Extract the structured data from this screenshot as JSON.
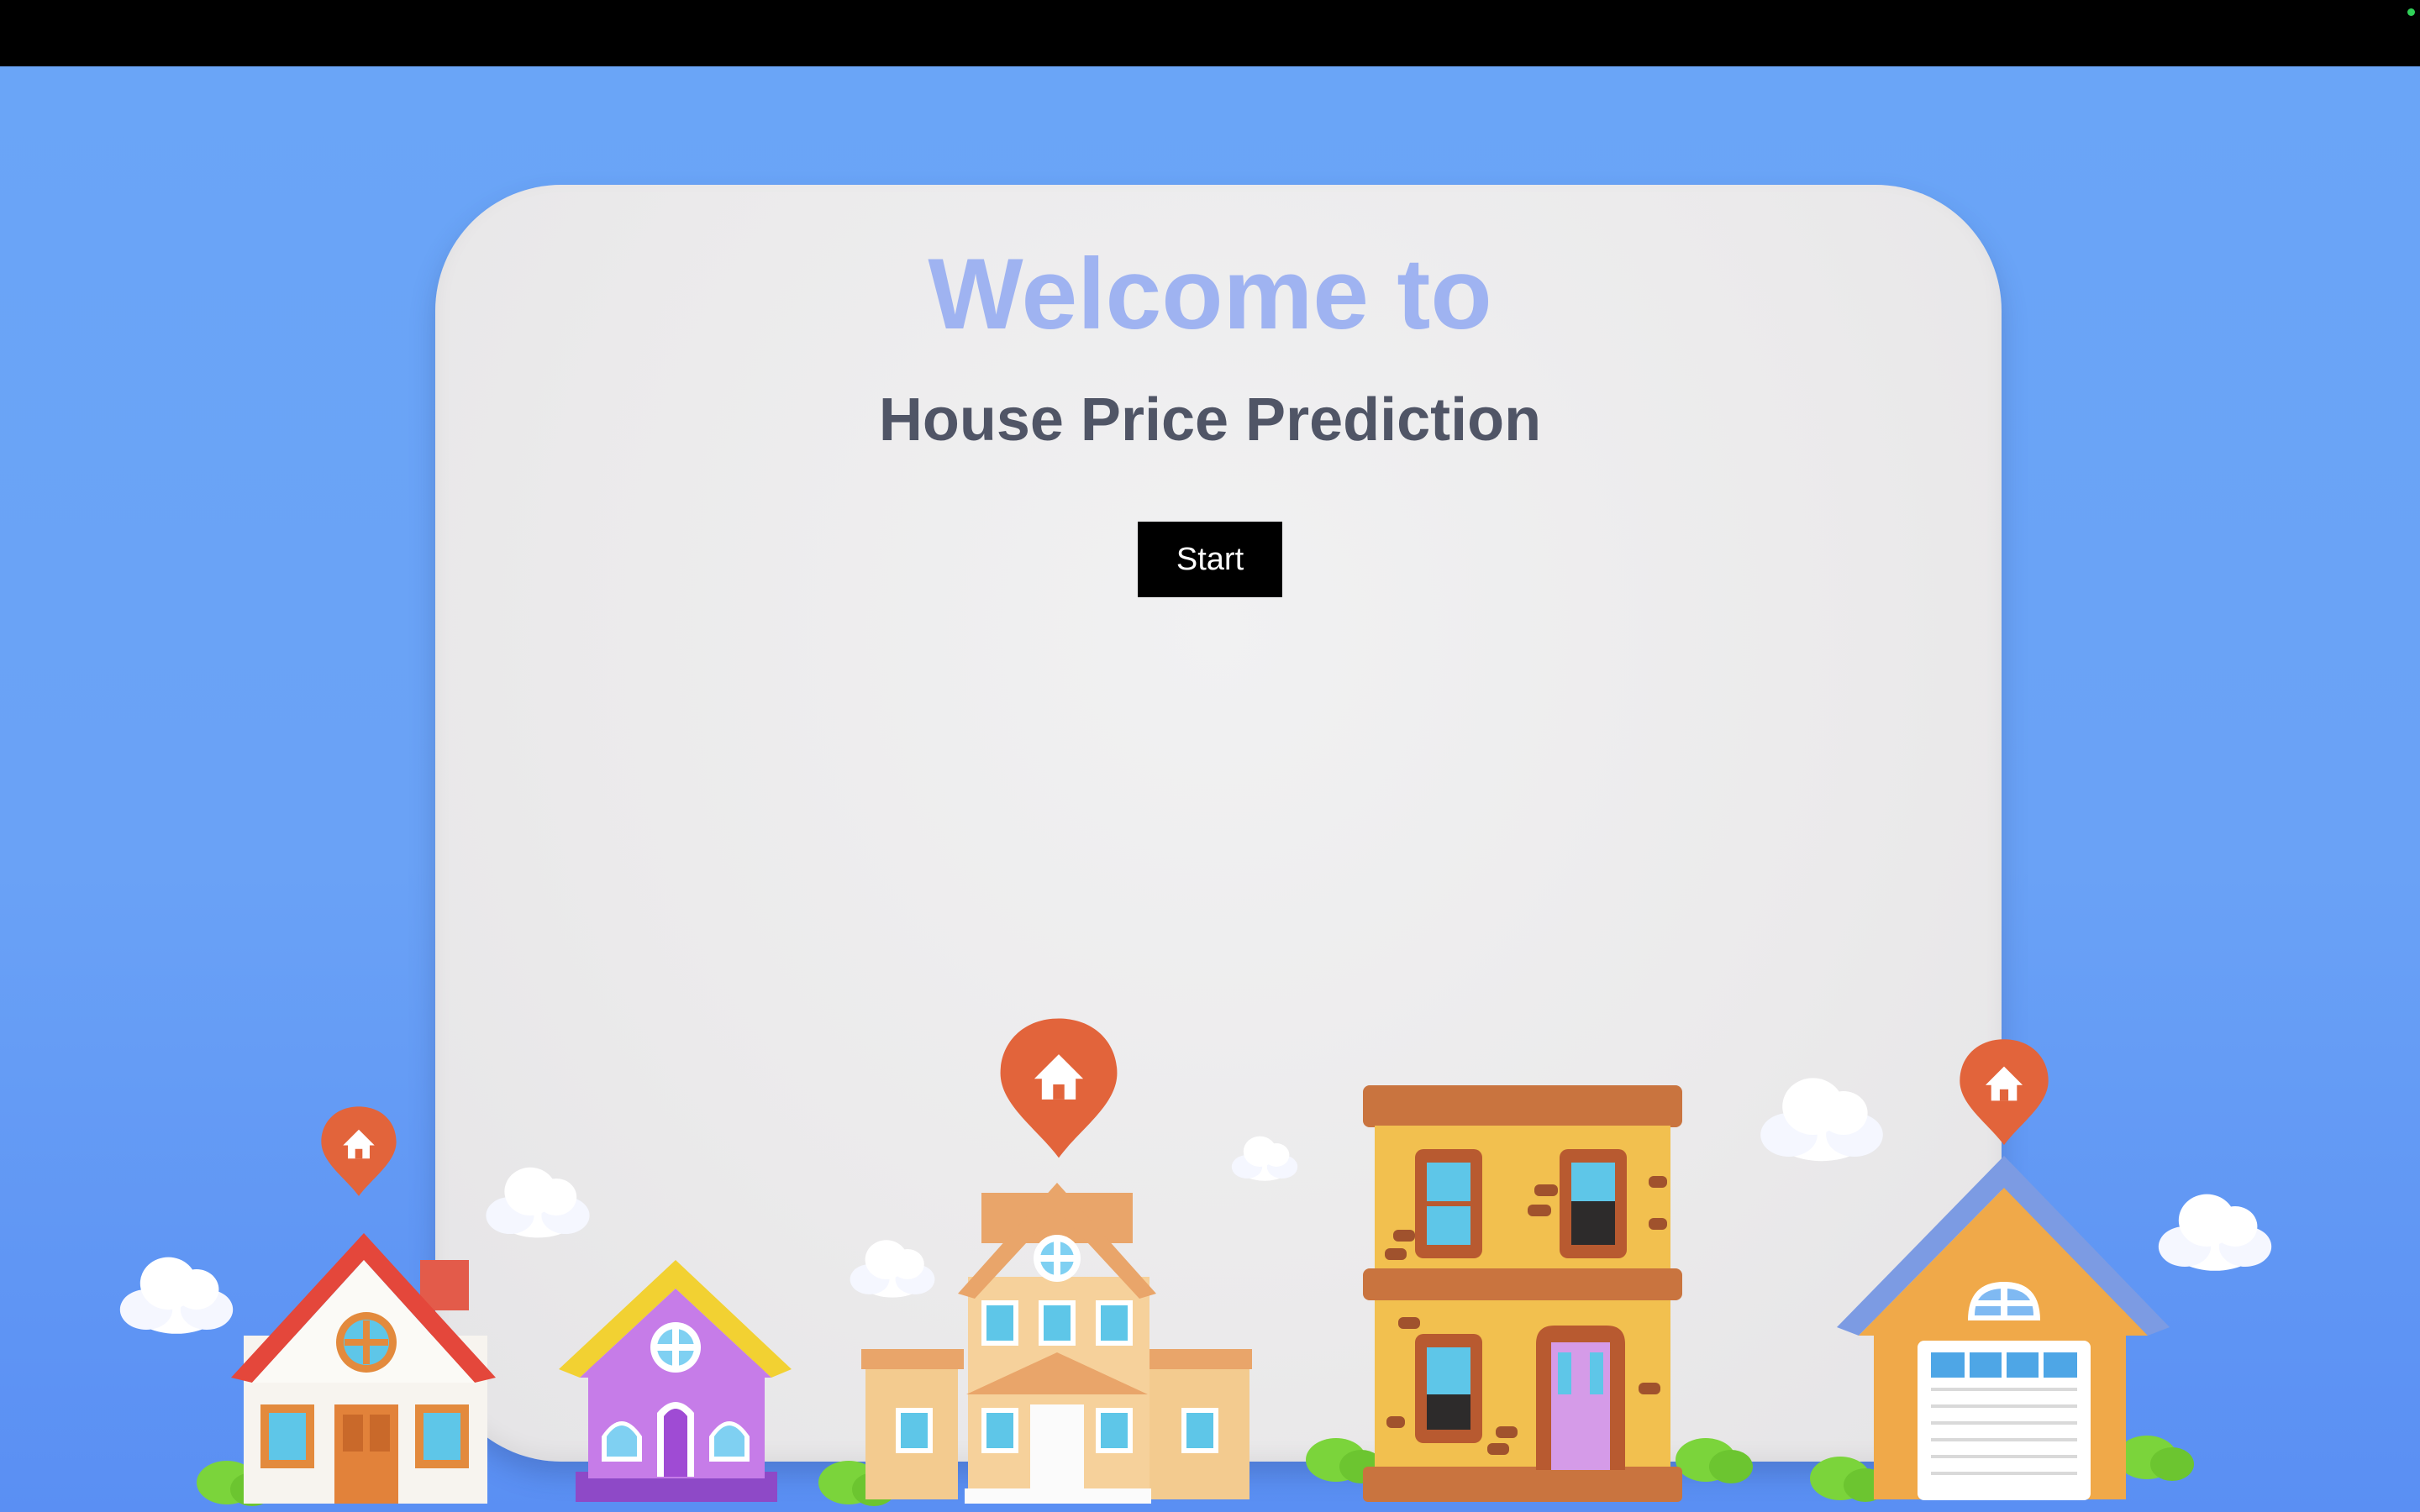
{
  "screen": {
    "welcome_text": "Welcome to",
    "title": "House Price Prediction",
    "start_label": "Start"
  },
  "colors": {
    "background": "#6aa5f7",
    "card": "#ececed",
    "welcome": "#9fb3f1",
    "title": "#505566",
    "button": "#000000",
    "button_text": "#ffffff",
    "pin": "#e2643b"
  },
  "illustration": {
    "houses": [
      "white-red-house",
      "purple-house",
      "beige-mansion",
      "yellow-apartment",
      "orange-garage-house"
    ],
    "icons": [
      "location-pin-home-icon",
      "cloud-icon",
      "bush-icon"
    ]
  }
}
